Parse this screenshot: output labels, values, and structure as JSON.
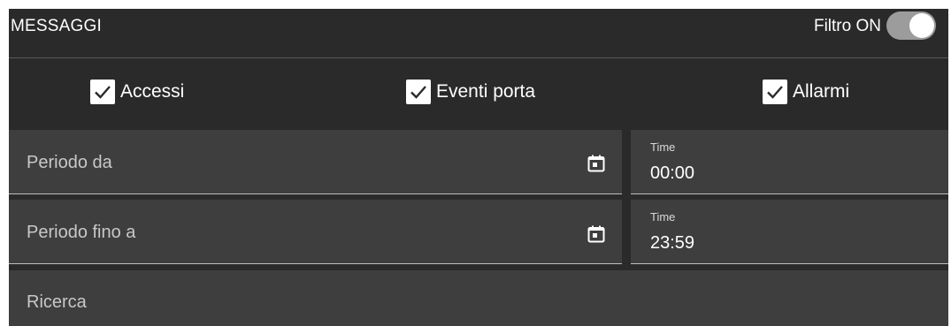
{
  "header": {
    "title": "MESSAGGI",
    "filter_label": "Filtro",
    "filter_state": "ON",
    "filter_on": true
  },
  "checkboxes": [
    {
      "label": "Accessi",
      "checked": true
    },
    {
      "label": "Eventi porta",
      "checked": true
    },
    {
      "label": "Allarmi",
      "checked": true
    }
  ],
  "period_from": {
    "placeholder": "Periodo da",
    "time_caption": "Time",
    "time_value": "00:00"
  },
  "period_to": {
    "placeholder": "Periodo fino a",
    "time_caption": "Time",
    "time_value": "23:59"
  },
  "search": {
    "placeholder": "Ricerca"
  },
  "icons": {
    "calendar": "calendar-icon",
    "check": "checkmark-icon"
  }
}
